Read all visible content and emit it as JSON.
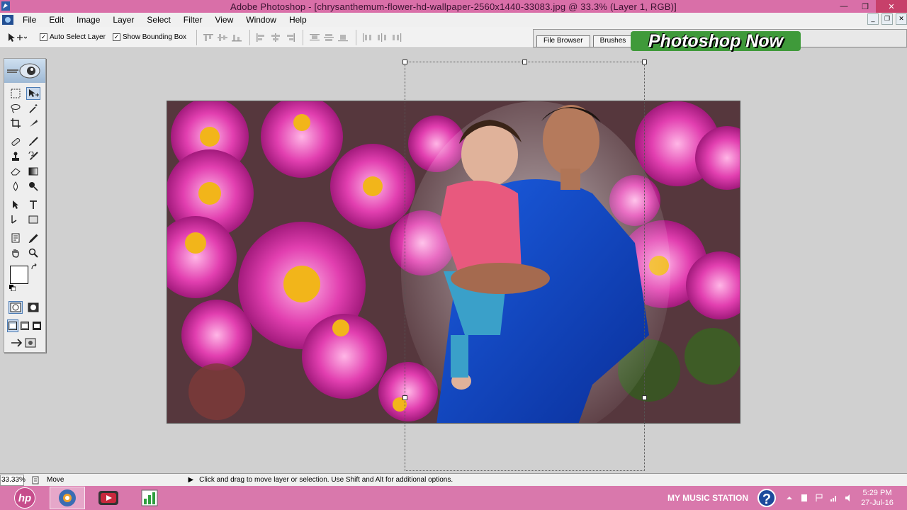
{
  "window": {
    "title": "Adobe Photoshop - [chrysanthemum-flower-hd-wallpaper-2560x1440-33083.jpg @ 33.3% (Layer 1, RGB)]",
    "controls": [
      "minimize-icon",
      "restore-icon",
      "close-icon"
    ]
  },
  "menu": {
    "items": [
      "File",
      "Edit",
      "Image",
      "Layer",
      "Select",
      "Filter",
      "View",
      "Window",
      "Help"
    ]
  },
  "options": {
    "auto_select_label": "Auto Select Layer",
    "auto_select_checked": true,
    "show_bbox_label": "Show Bounding Box",
    "show_bbox_checked": true,
    "well_tabs": [
      "File Browser",
      "Brushes"
    ]
  },
  "brand": {
    "text": "Photoshop Now"
  },
  "toolbox": {
    "tools": [
      "marquee-tool",
      "move-tool",
      "lasso-tool",
      "magic-wand-tool",
      "crop-tool",
      "slice-tool",
      "healing-brush-tool",
      "brush-tool",
      "clone-stamp-tool",
      "history-brush-tool",
      "eraser-tool",
      "gradient-tool",
      "blur-tool",
      "dodge-tool",
      "path-selection-tool",
      "type-tool",
      "pen-tool",
      "shape-tool",
      "notes-tool",
      "eyedropper-tool",
      "hand-tool",
      "zoom-tool"
    ],
    "foreground_color": "#ffffff",
    "background_color": "#ffffff"
  },
  "status": {
    "zoom": "33.33%",
    "tool": "Move",
    "hint": "Click and drag to move layer or selection.  Use Shift and Alt for additional options."
  },
  "taskbar": {
    "tasks": [
      "photoshop-icon",
      "media-player-icon",
      "spreadsheet-icon"
    ],
    "station_label": "MY MUSIC STATION",
    "time": "5:29 PM",
    "date": "27-Jul-16"
  },
  "colors": {
    "titlebar": "#d96fa8",
    "taskbar": "#d978ac",
    "brand_bg": "#3f9a3a"
  }
}
